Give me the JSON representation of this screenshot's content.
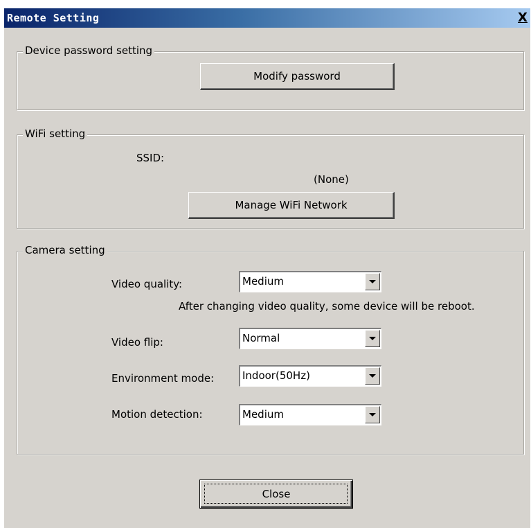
{
  "window": {
    "title": "Remote Setting",
    "close_glyph": "X"
  },
  "device_password": {
    "legend": "Device password setting",
    "modify_button": "Modify password"
  },
  "wifi": {
    "legend": "WiFi setting",
    "ssid_label": "SSID:",
    "ssid_value": "(None)",
    "manage_button": "Manage WiFi Network"
  },
  "camera": {
    "legend": "Camera setting",
    "video_quality": {
      "label": "Video quality:",
      "value": "Medium"
    },
    "video_quality_note": "After changing video quality, some device will be reboot.",
    "video_flip": {
      "label": "Video flip:",
      "value": "Normal"
    },
    "environment_mode": {
      "label": "Environment mode:",
      "value": "Indoor(50Hz)"
    },
    "motion_detection": {
      "label": "Motion detection:",
      "value": "Medium"
    }
  },
  "footer": {
    "close_button": "Close"
  }
}
